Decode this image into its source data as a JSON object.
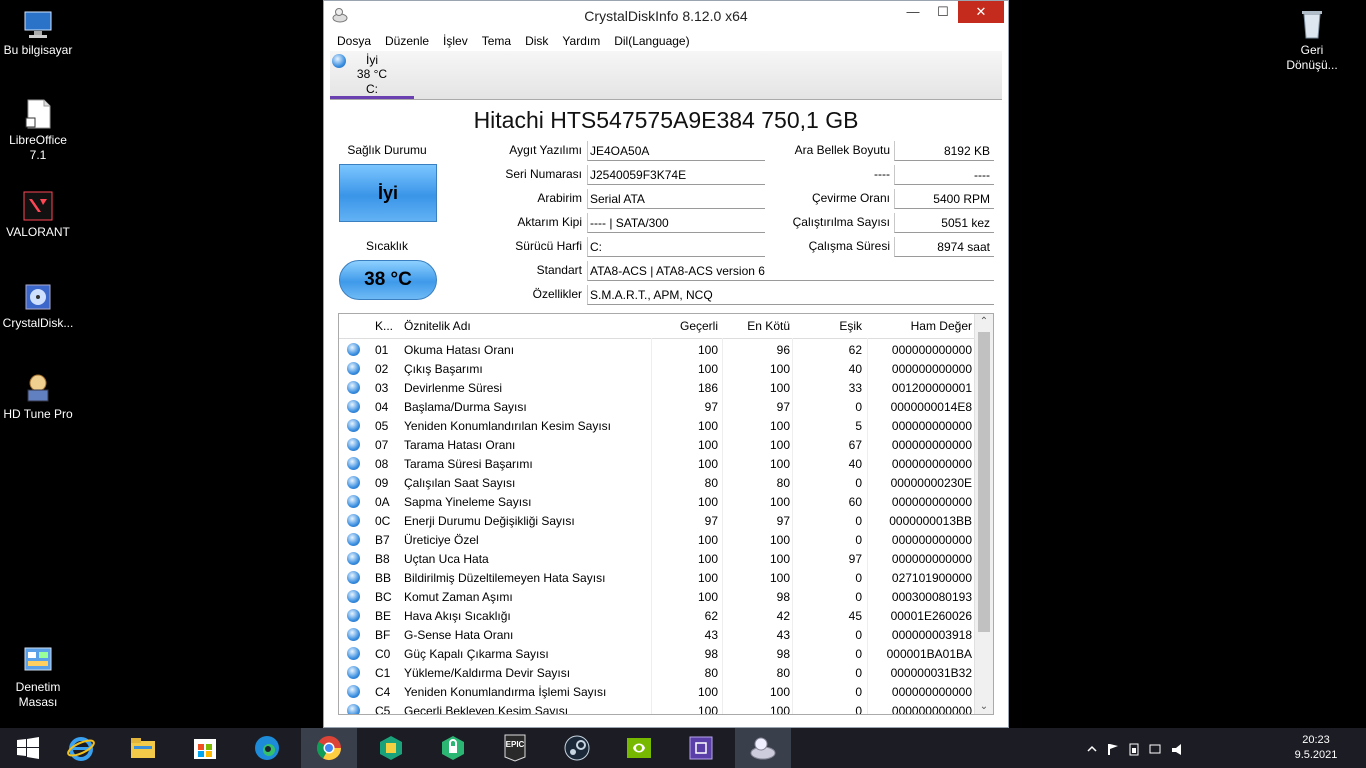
{
  "desktop": {
    "icons": [
      {
        "label": "Bu bilgisayar",
        "icon": "computer-icon"
      },
      {
        "label": "LibreOffice 7.1",
        "icon": "libreoffice-icon"
      },
      {
        "label": "VALORANT",
        "icon": "valorant-icon"
      },
      {
        "label": "CrystalDisk...",
        "icon": "crystaldisk-icon"
      },
      {
        "label": "HD Tune Pro",
        "icon": "hdtune-icon"
      },
      {
        "label": "Denetim Masası",
        "icon": "control-panel-icon"
      },
      {
        "label": "Geri Dönüşü...",
        "icon": "recycle-bin-icon"
      }
    ]
  },
  "window": {
    "title": "CrystalDiskInfo 8.12.0 x64",
    "min_glyph": "—",
    "max_glyph": "☐",
    "close_glyph": "✕"
  },
  "menu": [
    "Dosya",
    "Düzenle",
    "İşlev",
    "Tema",
    "Disk",
    "Yardım",
    "Dil(Language)"
  ],
  "drive_tab": {
    "status": "İyi",
    "temp": "38 °C",
    "letter": "C:"
  },
  "model": "Hitachi HTS547575A9E384 750,1 GB",
  "health": {
    "label": "Sağlık Durumu",
    "value": "İyi"
  },
  "temperature": {
    "label": "Sıcaklık",
    "value": "38 °C"
  },
  "info_left": [
    {
      "label": "Aygıt Yazılımı",
      "value": "JE4OA50A"
    },
    {
      "label": "Seri Numarası",
      "value": "J2540059F3K74E"
    },
    {
      "label": "Arabirim",
      "value": "Serial ATA"
    },
    {
      "label": "Aktarım Kipi",
      "value": "---- | SATA/300"
    },
    {
      "label": "Sürücü Harfi",
      "value": "C:"
    }
  ],
  "info_right": [
    {
      "label": "Ara Bellek Boyutu",
      "value": "8192 KB"
    },
    {
      "label": "----",
      "value": "----"
    },
    {
      "label": "Çevirme Oranı",
      "value": "5400 RPM"
    },
    {
      "label": "Çalıştırılma Sayısı",
      "value": "5051 kez"
    },
    {
      "label": "Çalışma Süresi",
      "value": "8974 saat"
    }
  ],
  "standard": {
    "label": "Standart",
    "value": "ATA8-ACS | ATA8-ACS version 6"
  },
  "features": {
    "label": "Özellikler",
    "value": "S.M.A.R.T., APM, NCQ"
  },
  "table": {
    "headers": [
      "K...",
      "Öznitelik Adı",
      "Geçerli",
      "En Kötü",
      "Eşik",
      "Ham Değer"
    ],
    "rows": [
      [
        "01",
        "Okuma Hatası Oranı",
        "100",
        "96",
        "62",
        "000000000000"
      ],
      [
        "02",
        "Çıkış Başarımı",
        "100",
        "100",
        "40",
        "000000000000"
      ],
      [
        "03",
        "Devirlenme Süresi",
        "186",
        "100",
        "33",
        "001200000001"
      ],
      [
        "04",
        "Başlama/Durma Sayısı",
        "97",
        "97",
        "0",
        "0000000014E8"
      ],
      [
        "05",
        "Yeniden Konumlandırılan Kesim Sayısı",
        "100",
        "100",
        "5",
        "000000000000"
      ],
      [
        "07",
        "Tarama Hatası Oranı",
        "100",
        "100",
        "67",
        "000000000000"
      ],
      [
        "08",
        "Tarama Süresi Başarımı",
        "100",
        "100",
        "40",
        "000000000000"
      ],
      [
        "09",
        "Çalışılan Saat Sayısı",
        "80",
        "80",
        "0",
        "00000000230E"
      ],
      [
        "0A",
        "Sapma Yineleme Sayısı",
        "100",
        "100",
        "60",
        "000000000000"
      ],
      [
        "0C",
        "Enerji Durumu Değişikliği Sayısı",
        "97",
        "97",
        "0",
        "0000000013BB"
      ],
      [
        "B7",
        "Üreticiye Özel",
        "100",
        "100",
        "0",
        "000000000000"
      ],
      [
        "B8",
        "Uçtan Uca Hata",
        "100",
        "100",
        "97",
        "000000000000"
      ],
      [
        "BB",
        "Bildirilmiş Düzeltilemeyen Hata Sayısı",
        "100",
        "100",
        "0",
        "027101900000"
      ],
      [
        "BC",
        "Komut Zaman Aşımı",
        "100",
        "98",
        "0",
        "000300080193"
      ],
      [
        "BE",
        "Hava Akışı Sıcaklığı",
        "62",
        "42",
        "45",
        "00001E260026"
      ],
      [
        "BF",
        "G-Sense Hata Oranı",
        "43",
        "43",
        "0",
        "000000003918"
      ],
      [
        "C0",
        "Güç Kapalı Çıkarma Sayısı",
        "98",
        "98",
        "0",
        "000001BA01BA"
      ],
      [
        "C1",
        "Yükleme/Kaldırma Devir Sayısı",
        "80",
        "80",
        "0",
        "000000031B32"
      ],
      [
        "C4",
        "Yeniden Konumlandırma İşlemi Sayısı",
        "100",
        "100",
        "0",
        "000000000000"
      ],
      [
        "C5",
        "Geçerli Bekleyen Kesim Sayısı",
        "100",
        "100",
        "0",
        "000000000000"
      ]
    ]
  },
  "taskbar": {
    "apps": [
      "start-icon",
      "internet-explorer-icon",
      "file-explorer-icon",
      "store-icon",
      "edge-icon",
      "chrome-icon",
      "app-green-icon",
      "vpn-icon",
      "epic-games-icon",
      "steam-icon",
      "nvidia-icon",
      "cpu-app-icon",
      "crystaldiskinfo-icon"
    ],
    "time": "20:23",
    "date": "9.5.2021"
  },
  "colors": {
    "accent": "#3b8fe0",
    "close": "#c42b1c",
    "tab_underline": "#6a3fb0"
  }
}
